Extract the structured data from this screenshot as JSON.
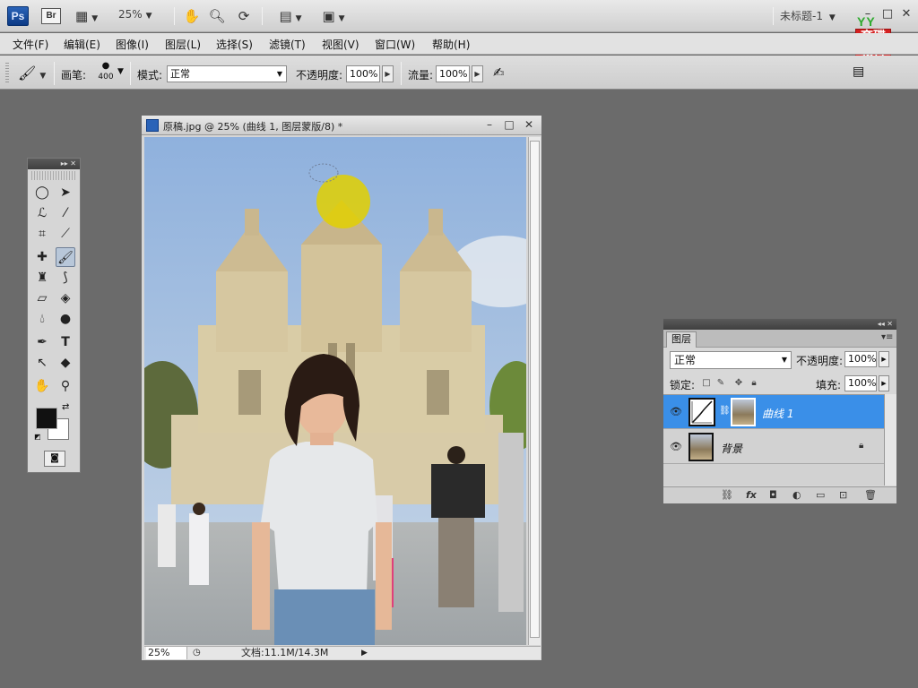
{
  "app": {
    "logo_label": "Ps",
    "bridge_label": "Br",
    "zoom_level": "25%",
    "document_selector": "未标题-1",
    "brand_top": "YY",
    "brand_line1": "育碟",
    "brand_line2": "教育"
  },
  "menu": [
    "文件(F)",
    "编辑(E)",
    "图像(I)",
    "图层(L)",
    "选择(S)",
    "滤镜(T)",
    "视图(V)",
    "窗口(W)",
    "帮助(H)"
  ],
  "options": {
    "brush_label": "画笔:",
    "brush_size": "400",
    "mode_label": "模式:",
    "mode_value": "正常",
    "opacity_label": "不透明度:",
    "opacity_value": "100%",
    "flow_label": "流量:",
    "flow_value": "100%"
  },
  "tools": {
    "items": [
      "ellipse-marquee",
      "move",
      "lasso",
      "magic-wand",
      "crop",
      "eyedropper",
      "spot-healing",
      "brush",
      "clone-stamp",
      "history-brush",
      "eraser",
      "paint-bucket",
      "blur",
      "dodge",
      "pen",
      "type",
      "path-selection",
      "shape",
      "hand",
      "zoom"
    ],
    "active": "brush",
    "foreground_color": "#111111",
    "background_color": "#ffffff"
  },
  "document": {
    "title": "原稿.jpg @ 25% (曲线 1, 图层蒙版/8) *",
    "status_zoom": "25%",
    "status_info": "文档:11.1M/14.3M"
  },
  "layers_panel": {
    "tab_label": "图层",
    "blend_mode": "正常",
    "opacity_label": "不透明度:",
    "opacity_value": "100%",
    "lock_label": "锁定:",
    "fill_label": "填充:",
    "fill_value": "100%",
    "layers": [
      {
        "name": "曲线 1",
        "selected": true
      },
      {
        "name": "背景",
        "selected": false
      }
    ]
  },
  "colors": {
    "workspace_bg": "#6b6b6b",
    "selection_blue": "#3a8fe8",
    "brand_red": "#d42020"
  }
}
